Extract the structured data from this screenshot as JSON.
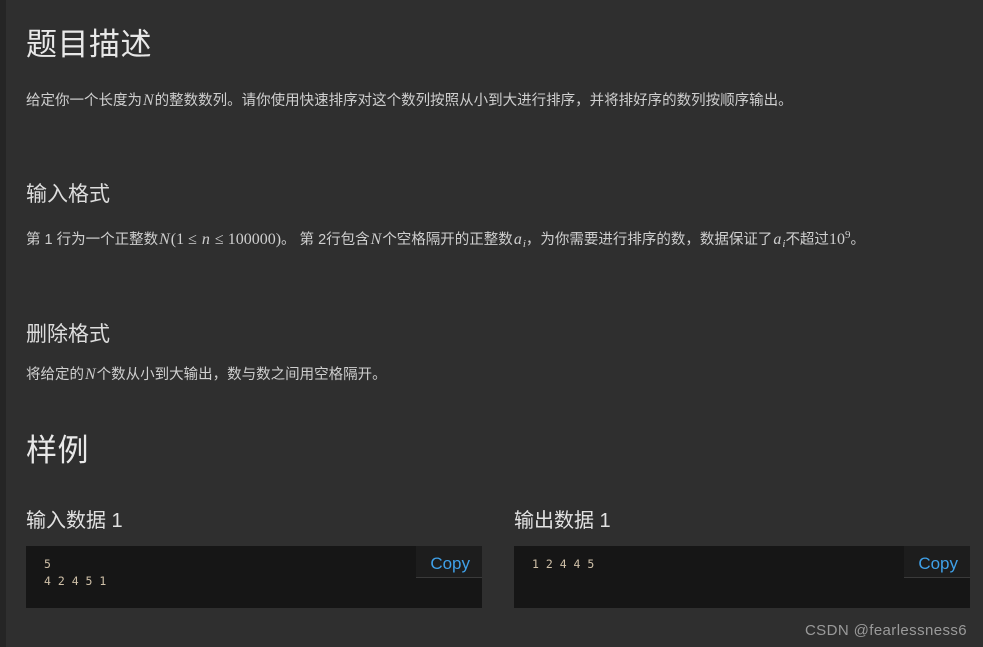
{
  "sections": {
    "description": {
      "heading": "题目描述",
      "paragraph_part1": "给定你一个长度为",
      "paragraph_math_n": "N",
      "paragraph_part2": "的整数数列。请你使用快速排序对这个数列按照从小到大进行排序，并将排好序的数列按顺序输出。"
    },
    "input_format": {
      "heading": "输入格式",
      "p_a": "第 1 行为一个正整数",
      "m_N": "N",
      "m_paren_open": "(",
      "m_one": "1",
      "m_le1": "≤",
      "m_n": "n",
      "m_le2": "≤",
      "m_limit": "100000",
      "m_paren_close": ")",
      "p_b": "。 第 2行包含",
      "m_N2": "N",
      "p_c": "个空格隔开的正整数",
      "m_a": "a",
      "m_a_sub": "i",
      "p_d": "，为你需要进行排序的数，数据保证了",
      "m_a2": "a",
      "m_a2_sub": "i",
      "p_e": "不超过",
      "m_ten": "10",
      "m_ten_sup": "9",
      "p_f": "。"
    },
    "output_format": {
      "heading": "删除格式",
      "p_a": "将给定的",
      "m_N": "N",
      "p_b": "个数从小到大输出，数与数之间用空格隔开。"
    },
    "sample": {
      "heading": "样例",
      "cases": [
        {
          "label": "输入数据 1",
          "code": "5\n4 2 4 5 1",
          "copy_label": "Copy"
        },
        {
          "label": "输出数据 1",
          "code": "1 2 4 4 5",
          "copy_label": "Copy"
        }
      ]
    }
  },
  "watermark": "CSDN @fearlessness6",
  "colors": {
    "page_background": "#2f2f2f",
    "gutter": "#252525",
    "code_background": "#161616",
    "code_text": "#cfc0a8",
    "copy_link": "#3fa0e8",
    "heading_text": "#e8e8e8",
    "body_text": "#cfcfcf",
    "watermark_text": "#9a9a9a"
  }
}
